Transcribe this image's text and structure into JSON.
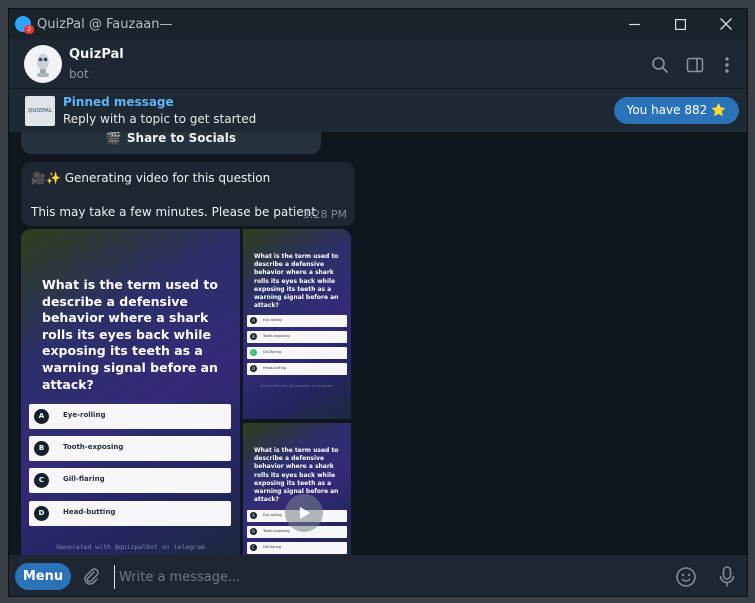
{
  "window": {
    "title": "QuizPal @ Fauzaan—",
    "badge_count": "2"
  },
  "header": {
    "name": "QuizPal",
    "status": "bot"
  },
  "pinned": {
    "title": "Pinned message",
    "text": "Reply with a topic to get started",
    "thumb_text": "QUIZPAL",
    "points_label": "You have 882 ⭐"
  },
  "messages": {
    "share_label": "Share to Socials",
    "share_icon": "🎬",
    "generating_text": "🎥✨ Generating video for this question",
    "patience_text": "This may take a few minutes. Please be patient",
    "time": "3:28 PM"
  },
  "quiz": {
    "question": "What is the term used to describe a defensive behavior where a shark rolls its eyes back while exposing its teeth as a warning signal before an attack?",
    "options": [
      {
        "letter": "A",
        "text": "Eye-rolling"
      },
      {
        "letter": "B",
        "text": "Tooth-exposing"
      },
      {
        "letter": "C",
        "text": "Gill-flaring"
      },
      {
        "letter": "D",
        "text": "Head-butting"
      }
    ],
    "footer": "Generated with @quizpalbot on telegram",
    "correct_option": "C"
  },
  "composer": {
    "menu_label": "Menu",
    "placeholder": "Write a message..."
  },
  "colors": {
    "accent": "#2b73b8",
    "link": "#5eb5f7",
    "bubble": "#1e2731",
    "chat_bg": "#0f161d",
    "correct": "#35b86a"
  }
}
